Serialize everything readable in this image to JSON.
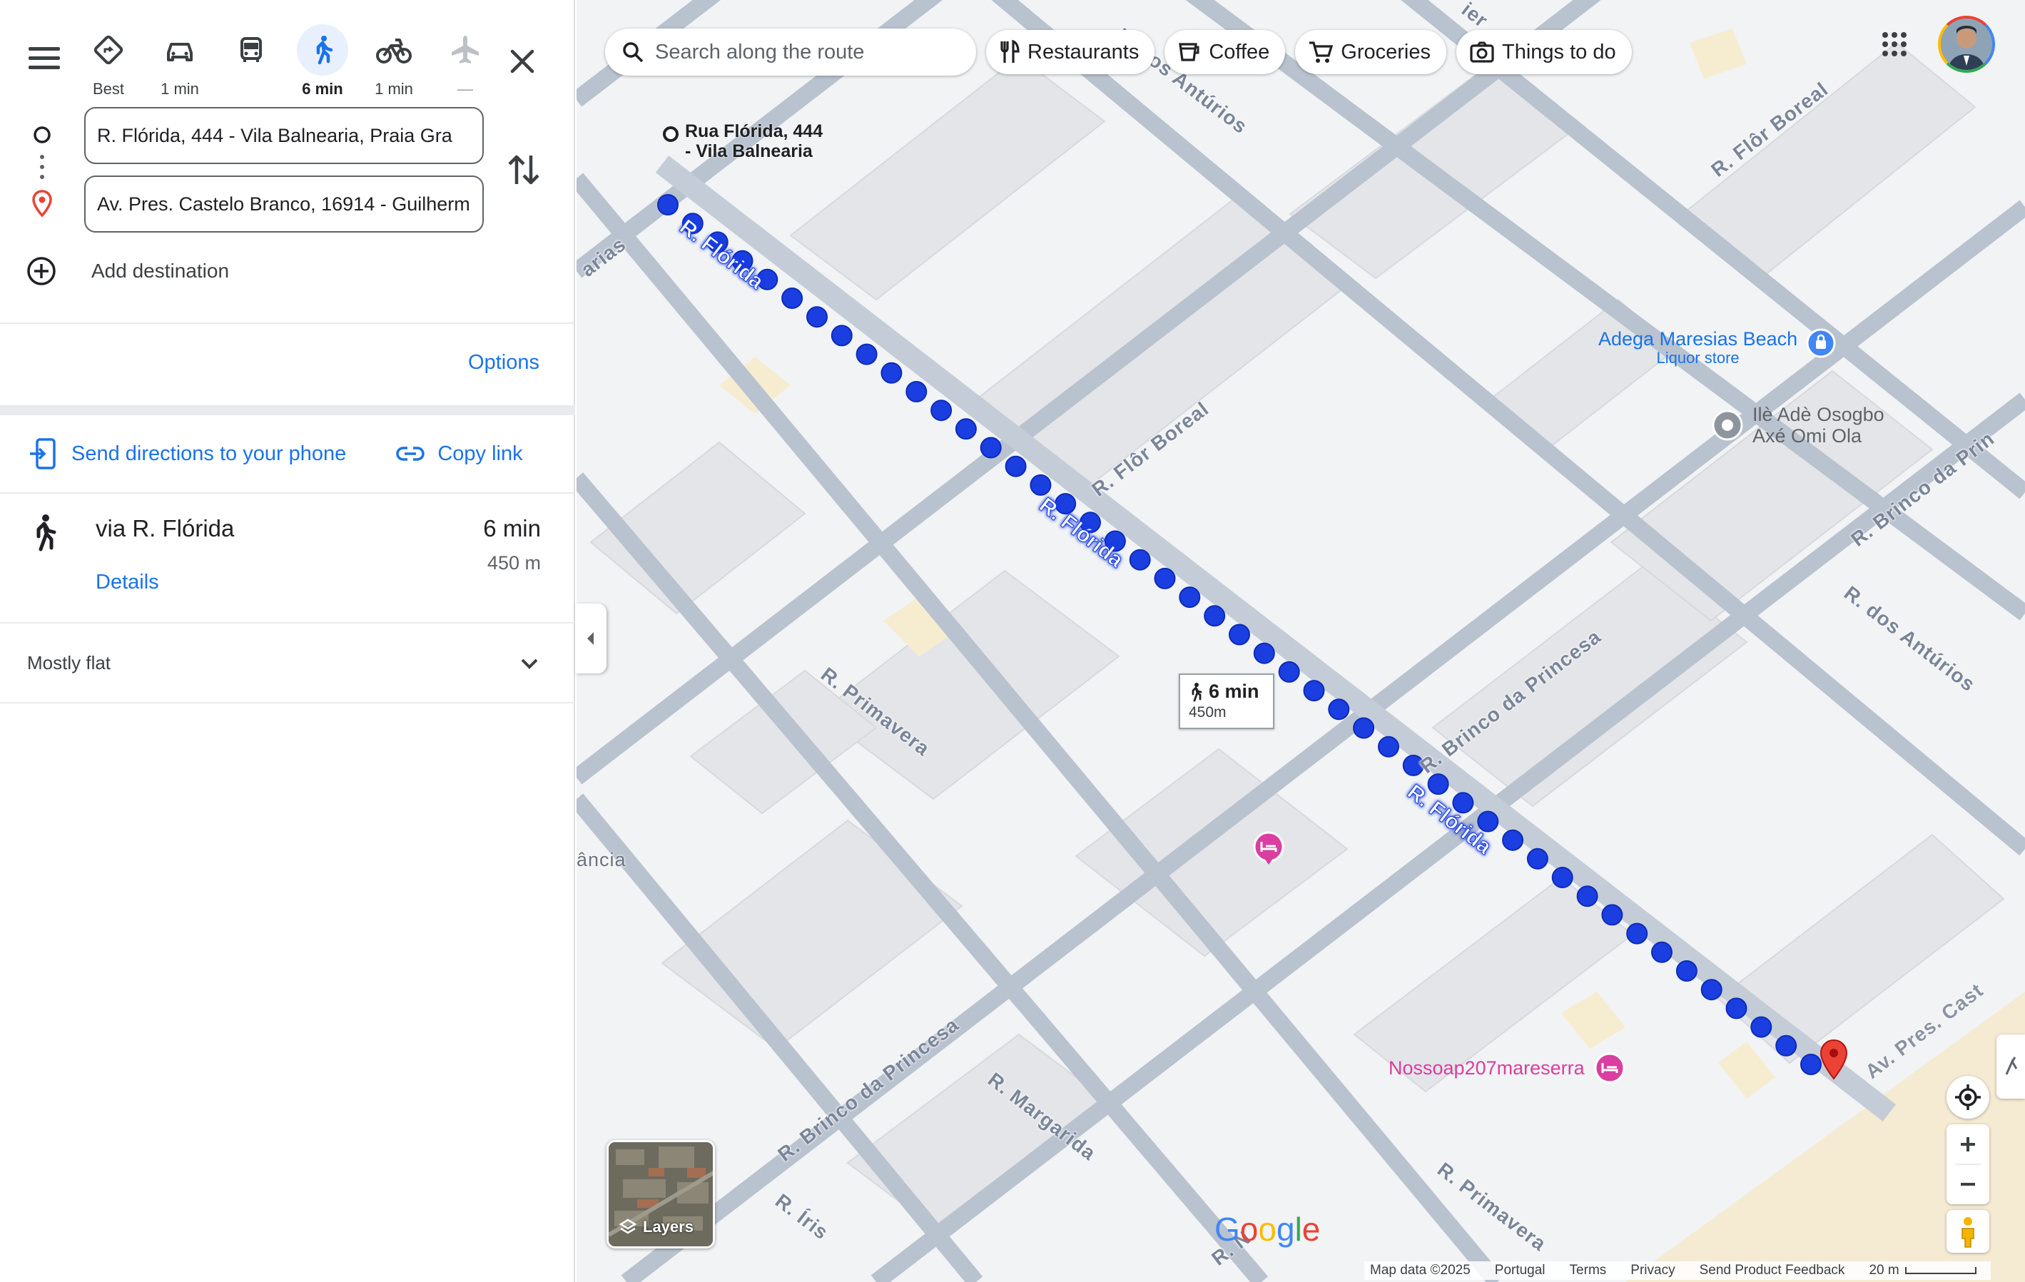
{
  "panel": {
    "travel_modes": [
      {
        "name": "best",
        "label": "Best"
      },
      {
        "name": "driving",
        "label": "1 min"
      },
      {
        "name": "transit",
        "label": ""
      },
      {
        "name": "walking",
        "label": "6 min",
        "active": true
      },
      {
        "name": "cycling",
        "label": "1 min"
      },
      {
        "name": "flights",
        "label": "—"
      }
    ],
    "origin_value": "R. Flórida, 444 - Vila Balnearia, Praia Gra",
    "destination_value": "Av. Pres. Castelo Branco, 16914 - Guilherm",
    "add_destination_label": "Add destination",
    "options_label": "Options",
    "send_directions_label": "Send directions to your phone",
    "copy_link_label": "Copy link",
    "route": {
      "via": "via R. Flórida",
      "time": "6 min",
      "distance": "450 m",
      "details_label": "Details"
    },
    "elevation_label": "Mostly flat"
  },
  "map": {
    "search_placeholder": "Search along the route",
    "chips": [
      {
        "icon": "fork-knife-icon",
        "label": "Restaurants"
      },
      {
        "icon": "coffee-cup-icon",
        "label": "Coffee"
      },
      {
        "icon": "shopping-cart-icon",
        "label": "Groceries"
      },
      {
        "icon": "camera-icon",
        "label": "Things to do"
      }
    ],
    "origin_marker_label": {
      "line1": "Rua Flórida, 444",
      "line2": "- Vila Balnearia"
    },
    "route_time_box": {
      "time": "6 min",
      "distance": "450m"
    },
    "pois": {
      "adega_name": "Adega Maresias Beach",
      "adega_type": "Liquor store",
      "ile_line1": "Ilè Adè Osogbo",
      "ile_line2": "Axé Omi Ola",
      "nossoap": "Nossoap207mareserra"
    },
    "street_labels": {
      "florida_1": "R. Flórida",
      "florida_2": "R. Flórida",
      "florida_3": "R. Flórida",
      "flor_boreal_1": "R. Flôr Boreal",
      "flor_boreal_2": "R. Flôr Boreal",
      "anturios_top": "R. dos Antúrios",
      "brinco_right": "R. Brinco da Prin",
      "anturios_right": "R. dos Antúrios",
      "brinco_mid": "R. Brinco da Princesa",
      "primavera_1": "R. Primavera",
      "brinco_bottom": "R. Brinco da Princesa",
      "margarida": "R. Margarida",
      "primavera_2": "R. Primavera",
      "iris": "R. Íris",
      "castelo": "Av. Pres. Cast",
      "left_fragment_1": "arias",
      "left_fragment_2": "ância",
      "top_fragment": "ier",
      "bottom_fragment": "R. N"
    },
    "layers_label": "Layers",
    "logo_text": "Google",
    "footer": {
      "map_data": "Map data ©2025",
      "country": "Portugal",
      "terms": "Terms",
      "privacy": "Privacy",
      "feedback": "Send Product Feedback",
      "scale": "20 m"
    },
    "colors": {
      "route": "#1a3ee0",
      "accent": "#1a73e8",
      "road": "#aab4c4",
      "building": "#e8eaed",
      "poi_pink": "#d93ea0",
      "poi_blue": "#1a73e8"
    }
  }
}
